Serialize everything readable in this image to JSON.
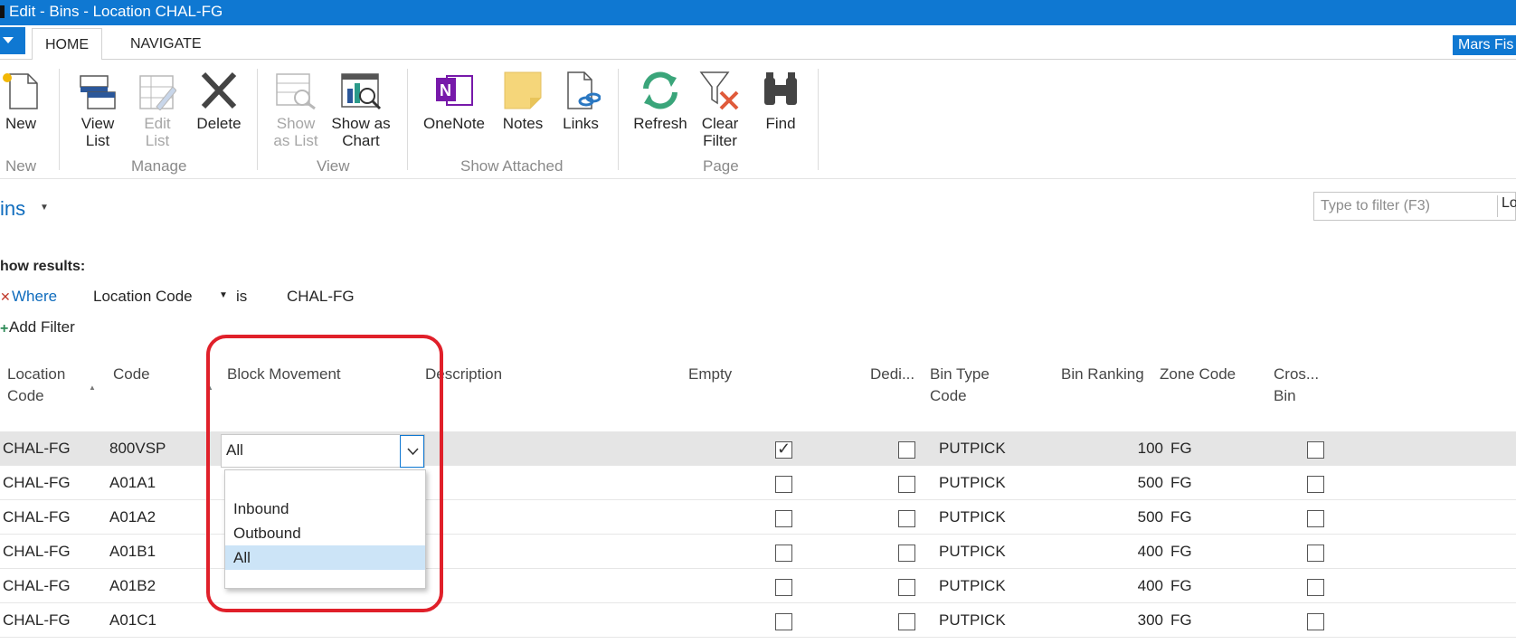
{
  "window": {
    "title": "Edit - Bins - Location CHAL-FG"
  },
  "tabs": {
    "home": "HOME",
    "navigate": "NAVIGATE"
  },
  "user": {
    "name": "Mars Fis"
  },
  "ribbon": {
    "new_group": {
      "name": "New",
      "new": "New"
    },
    "manage": {
      "name": "Manage",
      "view_list": [
        "View",
        "List"
      ],
      "edit_list": [
        "Edit",
        "List"
      ],
      "delete": "Delete"
    },
    "view": {
      "name": "View",
      "show_as_list": [
        "Show",
        "as List"
      ],
      "show_as_chart": [
        "Show as",
        "Chart"
      ]
    },
    "show_attached": {
      "name": "Show Attached",
      "onenote": "OneNote",
      "notes": "Notes",
      "links": "Links"
    },
    "page": {
      "name": "Page",
      "refresh": "Refresh",
      "clear_filter": [
        "Clear",
        "Filter"
      ],
      "find": "Find"
    }
  },
  "page": {
    "title": "ins",
    "filter_placeholder": "Type to filter (F3)",
    "filter_field": "Lo",
    "show_results": "how results:",
    "where": "Where",
    "filter_field_name": "Location Code",
    "filter_operator": "is",
    "filter_value": "CHAL-FG",
    "add_filter": "Add Filter"
  },
  "grid": {
    "headers": {
      "location_code": [
        "Location",
        "Code"
      ],
      "code": "Code",
      "block_movement": "Block Movement",
      "description": "Description",
      "empty": "Empty",
      "dedicated": "Dedi...",
      "bin_type_code": [
        "Bin Type",
        "Code"
      ],
      "bin_ranking": "Bin Ranking",
      "zone_code": "Zone Code",
      "cross_bin": [
        "Cros...",
        "Bin"
      ]
    },
    "rows": [
      {
        "location": "CHAL-FG",
        "code": "800VSP",
        "empty": true,
        "dedicated": false,
        "bin_type": "PUTPICK",
        "ranking": "100",
        "zone": "FG",
        "cross_dock": false
      },
      {
        "location": "CHAL-FG",
        "code": "A01A1",
        "empty": false,
        "dedicated": false,
        "bin_type": "PUTPICK",
        "ranking": "500",
        "zone": "FG",
        "cross_dock": false
      },
      {
        "location": "CHAL-FG",
        "code": "A01A2",
        "empty": false,
        "dedicated": false,
        "bin_type": "PUTPICK",
        "ranking": "500",
        "zone": "FG",
        "cross_dock": false
      },
      {
        "location": "CHAL-FG",
        "code": "A01B1",
        "empty": false,
        "dedicated": false,
        "bin_type": "PUTPICK",
        "ranking": "400",
        "zone": "FG",
        "cross_dock": false
      },
      {
        "location": "CHAL-FG",
        "code": "A01B2",
        "empty": false,
        "dedicated": false,
        "bin_type": "PUTPICK",
        "ranking": "400",
        "zone": "FG",
        "cross_dock": false
      },
      {
        "location": "CHAL-FG",
        "code": "A01C1",
        "empty": false,
        "dedicated": false,
        "bin_type": "PUTPICK",
        "ranking": "300",
        "zone": "FG",
        "cross_dock": false
      }
    ]
  },
  "block_movement_editor": {
    "current_value": "All",
    "options": [
      "",
      "Inbound",
      "Outbound",
      "All"
    ],
    "selected_option": "All"
  },
  "colors": {
    "accent": "#0f78d2",
    "highlight": "#e0202a",
    "selected_row": "#e5e5e5",
    "selected_option": "#cce4f7"
  }
}
